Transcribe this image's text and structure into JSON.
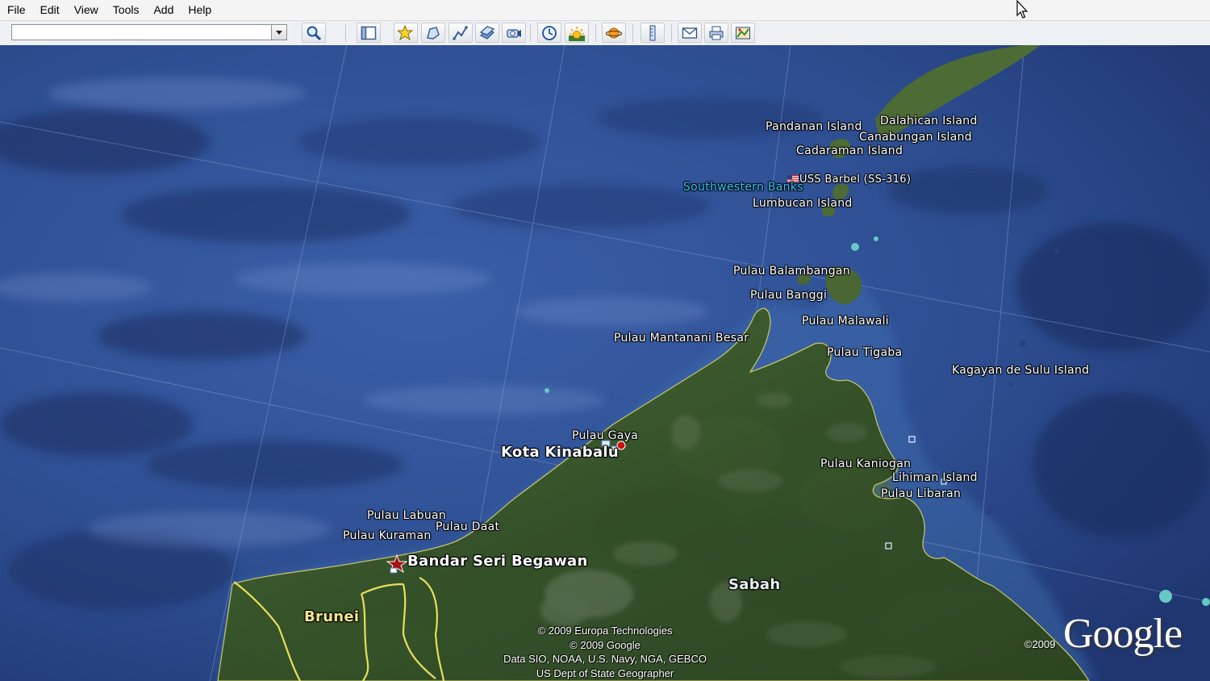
{
  "menu": {
    "items": [
      {
        "label": "File"
      },
      {
        "label": "Edit"
      },
      {
        "label": "View"
      },
      {
        "label": "Tools"
      },
      {
        "label": "Add"
      },
      {
        "label": "Help"
      }
    ]
  },
  "toolbar": {
    "search_value": "",
    "buttons": [
      {
        "name": "search-button",
        "icon": "magnifier-icon"
      },
      {
        "name": "sidebar-toggle-button",
        "icon": "panel-icon"
      },
      {
        "name": "add-placemark-button",
        "icon": "pushpin-icon"
      },
      {
        "name": "add-polygon-button",
        "icon": "polygon-icon"
      },
      {
        "name": "add-path-button",
        "icon": "path-icon"
      },
      {
        "name": "add-image-overlay-button",
        "icon": "overlay-icon"
      },
      {
        "name": "record-tour-button",
        "icon": "camera-icon"
      },
      {
        "name": "historical-imagery-button",
        "icon": "clock-icon"
      },
      {
        "name": "sunlight-button",
        "icon": "sun-icon"
      },
      {
        "name": "planets-button",
        "icon": "planet-icon"
      },
      {
        "name": "ruler-button",
        "icon": "ruler-icon"
      },
      {
        "name": "email-button",
        "icon": "envelope-icon"
      },
      {
        "name": "print-button",
        "icon": "printer-icon"
      },
      {
        "name": "view-in-maps-button",
        "icon": "map-icon"
      }
    ]
  },
  "map": {
    "labels": {
      "pandanan": "Pandanan Island",
      "dalahican": "Dalahican Island",
      "canabungan": "Canabungan Island",
      "cadaraman": "Cadaraman Island",
      "uss_barbel": "USS Barbel (SS-316)",
      "southwestern_banks": "Southwestern Banks",
      "lumbucan": "Lumbucan Island",
      "balambangan": "Pulau Balambangan",
      "banggi": "Pulau Banggi",
      "malawali": "Pulau Malawali",
      "mantanani": "Pulau Mantanani Besar",
      "tigaba": "Pulau Tigaba",
      "kagayan": "Kagayan de Sulu Island",
      "gaya": "Pulau Gaya",
      "kota_kinabalu": "Kota Kinabalu",
      "kaniogan": "Pulau Kaniogan",
      "lihiman": "Lihiman Island",
      "libaran": "Pulau Libaran",
      "labuan": "Pulau Labuan",
      "daat": "Pulau Daat",
      "kuraman": "Pulau Kuraman",
      "bandar": "Bandar Seri Begawan",
      "sabah": "Sabah",
      "brunei": "Brunei"
    },
    "credits": {
      "line1": "© 2009 Europa Technologies",
      "line2": "© 2009 Google",
      "line3": "Data SIO, NOAA, U.S. Navy, NGA, GEBCO",
      "line4": "US Dept of State Geographer",
      "year": "©2009",
      "logo": "Google"
    },
    "colors": {
      "ocean": "#2c4f92",
      "land": "#3b5a2b",
      "border": "#e8e05a"
    }
  }
}
